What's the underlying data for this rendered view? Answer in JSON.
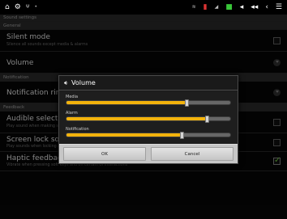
{
  "statusbar": {
    "left_icons": [
      "home-icon",
      "settings-icon",
      "usb-icon",
      "notification-icon"
    ],
    "right_icons": [
      "wifi-icon",
      "battery-icon",
      "signal-icon",
      "volume-down-icon",
      "volume-up-icon",
      "back-icon",
      "menu-icon"
    ]
  },
  "settings": {
    "header": "Sound settings",
    "sections": [
      {
        "label": "General"
      },
      {
        "label": "Notification"
      },
      {
        "label": "Feedback"
      }
    ],
    "items": [
      {
        "title": "Silent mode",
        "subtitle": "Silence all sounds except media & alarms",
        "type": "checkbox",
        "checked": false
      },
      {
        "title": "Volume",
        "subtitle": "",
        "type": "arrow"
      },
      {
        "title": "Notification ringtone",
        "subtitle": "",
        "type": "arrow"
      },
      {
        "title": "Audible selection",
        "subtitle": "Play sound when making screen selection",
        "type": "checkbox",
        "checked": false
      },
      {
        "title": "Screen lock sounds",
        "subtitle": "Play sounds when locking and unlocking the screen",
        "type": "checkbox",
        "checked": false
      },
      {
        "title": "Haptic feedback",
        "subtitle": "Vibrate when pressing soft keys and on certain UI interactions",
        "type": "checkbox",
        "checked": true
      }
    ]
  },
  "dialog": {
    "title": "Volume",
    "sliders": [
      {
        "label": "Media",
        "value": 0.74
      },
      {
        "label": "Alarm",
        "value": 0.86
      },
      {
        "label": "Notification",
        "value": 0.71
      }
    ],
    "ok_label": "OK",
    "cancel_label": "Cancel"
  },
  "colors": {
    "accent": "#f3b30c",
    "check": "#7bd34a"
  }
}
